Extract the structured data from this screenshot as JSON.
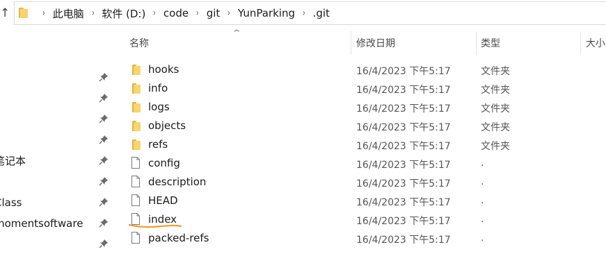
{
  "nav_up": "↑",
  "breadcrumb": [
    "此电脑",
    "软件 (D:)",
    "code",
    "git",
    "YunParking",
    ".git"
  ],
  "breadcrumb_separator": "›",
  "nav_pane": {
    "items": [
      {
        "label": "",
        "pinned": true
      },
      {
        "label": "",
        "pinned": true
      },
      {
        "label": "",
        "pinned": true
      },
      {
        "label": "",
        "pinned": true
      },
      {
        "label": "笔记本",
        "pinned": true
      },
      {
        "label": "",
        "pinned": true
      },
      {
        "label": "Class",
        "pinned": true
      },
      {
        "label": "momentsoftware",
        "pinned": true
      },
      {
        "label": "",
        "pinned": true
      }
    ]
  },
  "columns": {
    "name": "名称",
    "modified": "修改日期",
    "type": "类型",
    "size": "大小"
  },
  "files": [
    {
      "name": "hooks",
      "modified": "16/4/2023 下午5:17",
      "type": "文件夹",
      "kind": "folder"
    },
    {
      "name": "info",
      "modified": "16/4/2023 下午5:17",
      "type": "文件夹",
      "kind": "folder"
    },
    {
      "name": "logs",
      "modified": "16/4/2023 下午5:17",
      "type": "文件夹",
      "kind": "folder"
    },
    {
      "name": "objects",
      "modified": "16/4/2023 下午5:17",
      "type": "文件夹",
      "kind": "folder"
    },
    {
      "name": "refs",
      "modified": "16/4/2023 下午5:17",
      "type": "文件夹",
      "kind": "folder"
    },
    {
      "name": "config",
      "modified": "16/4/2023 下午5:17",
      "type": ".",
      "kind": "file"
    },
    {
      "name": "description",
      "modified": "16/4/2023 下午5:17",
      "type": ".",
      "kind": "file"
    },
    {
      "name": "HEAD",
      "modified": "16/4/2023 下午5:17",
      "type": ".",
      "kind": "file"
    },
    {
      "name": "index",
      "modified": "16/4/2023 下午5:17",
      "type": ".",
      "kind": "file"
    },
    {
      "name": "packed-refs",
      "modified": "16/4/2023 下午5:17",
      "type": ".",
      "kind": "file"
    }
  ],
  "colors": {
    "folder": "#f8d56d",
    "folder_back": "#e5b240",
    "annotation_underline": "#f0a030"
  }
}
